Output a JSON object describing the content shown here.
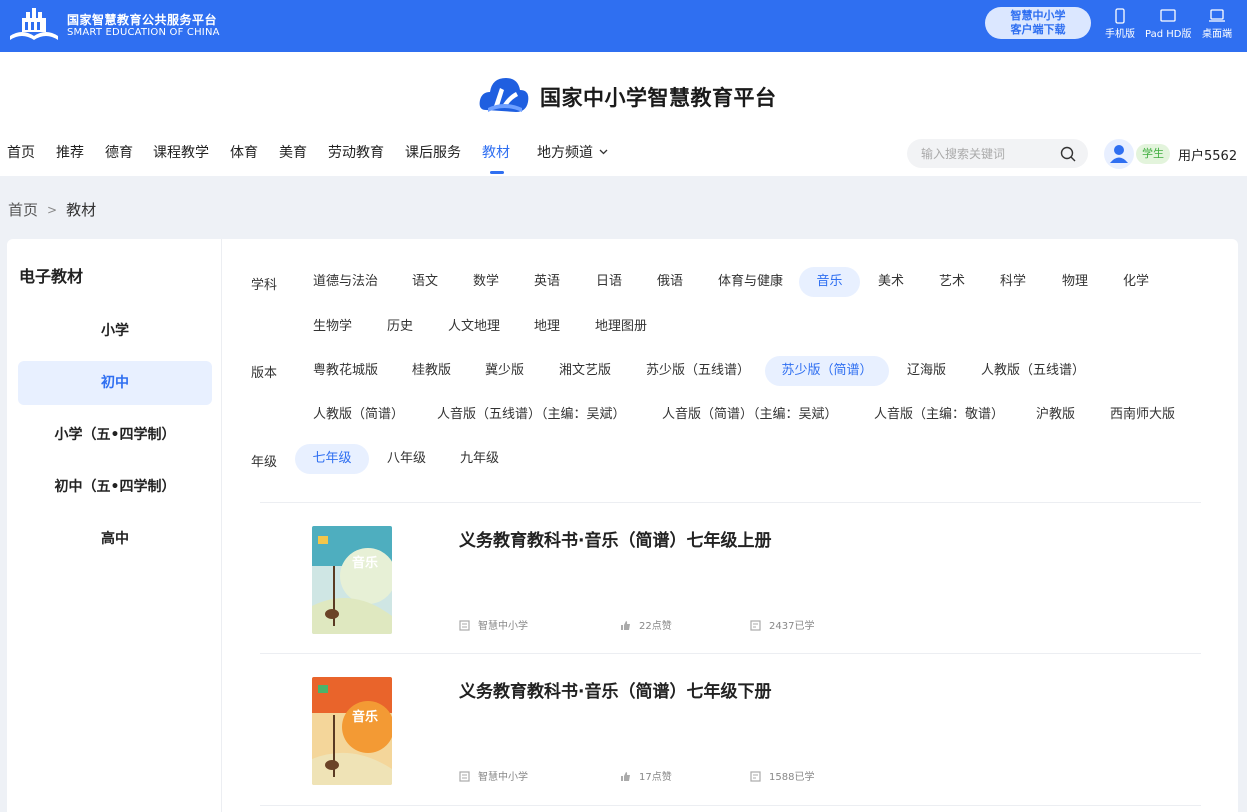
{
  "topbar": {
    "brand_cn": "国家智慧教育公共服务平台",
    "brand_en": "SMART EDUCATION OF CHINA",
    "download_line1": "智慧中小学",
    "download_line2": "客户端下载",
    "devices": [
      "手机版",
      "Pad HD版",
      "桌面端"
    ],
    "bg_color": "#2f6ff1"
  },
  "header": {
    "title": "国家中小学智慧教育平台",
    "nav": [
      "首页",
      "推荐",
      "德育",
      "课程教学",
      "体育",
      "美育",
      "劳动教育",
      "课后服务",
      "教材",
      "地方频道"
    ],
    "active_nav": "教材",
    "search_placeholder": "输入搜索关键词",
    "role_badge": "学生",
    "username": "用户5562"
  },
  "breadcrumb": {
    "home": "首页",
    "sep": ">",
    "current": "教材"
  },
  "sidebar": {
    "title": "电子教材",
    "items": [
      "小学",
      "初中",
      "小学（五•四学制）",
      "初中（五•四学制）",
      "高中"
    ],
    "active": "初中"
  },
  "filters": {
    "subject_label": "学科",
    "subjects": [
      "道德与法治",
      "语文",
      "数学",
      "英语",
      "日语",
      "俄语",
      "体育与健康",
      "音乐",
      "美术",
      "艺术",
      "科学",
      "物理",
      "化学",
      "生物学",
      "历史",
      "人文地理",
      "地理",
      "地理图册"
    ],
    "subject_selected": "音乐",
    "edition_label": "版本",
    "editions": [
      "粤教花城版",
      "桂教版",
      "冀少版",
      "湘文艺版",
      "苏少版（五线谱）",
      "苏少版（简谱）",
      "辽海版",
      "人教版（五线谱）",
      "人教版（简谱）",
      "人音版（五线谱）（主编：吴斌）",
      "人音版（简谱）（主编：吴斌）",
      "人音版（主编：敬谱）",
      "沪教版",
      "西南师大版"
    ],
    "edition_selected": "苏少版（简谱）",
    "grade_label": "年级",
    "grades": [
      "七年级",
      "八年级",
      "九年级"
    ],
    "grade_selected": "七年级"
  },
  "books": [
    {
      "title": "义务教育教科书·音乐（简谱）七年级上册",
      "cover_text": "音乐",
      "publisher": "智慧中小学",
      "likes": "22点赞",
      "learners": "2437已学"
    },
    {
      "title": "义务教育教科书·音乐（简谱）七年级下册",
      "cover_text": "音乐",
      "publisher": "智慧中小学",
      "likes": "17点赞",
      "learners": "1588已学"
    }
  ]
}
